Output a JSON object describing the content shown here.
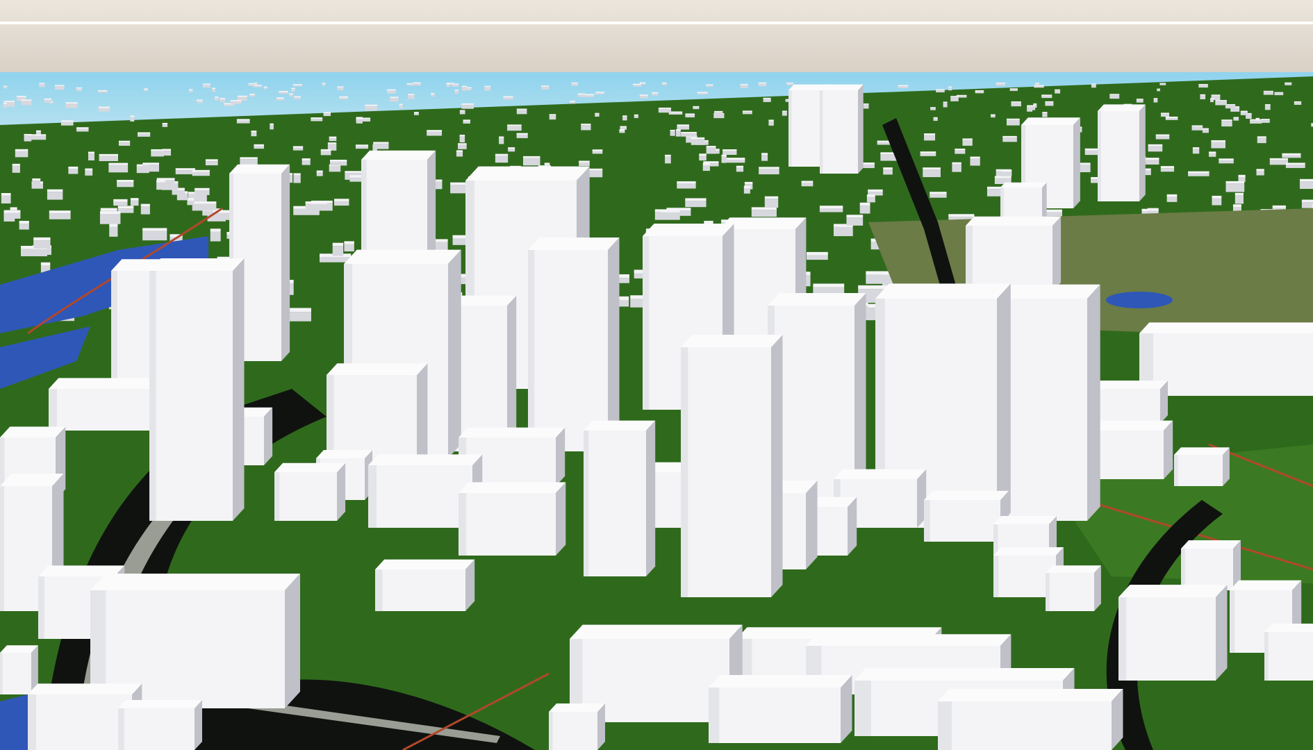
{
  "scene": {
    "kind": "3d-city-model-render",
    "colors": {
      "sky_top": "#ece6dd",
      "haze": "#d8cfc4",
      "horizon_line": "#ffffff",
      "sea": "#8fd3ee",
      "building": "#f4f4f6",
      "building_shade": "#d7d8de",
      "building_dark": "#bfc0c8",
      "ground_green": "#2f6a1c",
      "road_black": "#101210",
      "road_gray": "#9a9d93",
      "water_blue": "#2f57b8",
      "rail_red": "#b1482a",
      "park_olive": "#6b7c46"
    }
  }
}
